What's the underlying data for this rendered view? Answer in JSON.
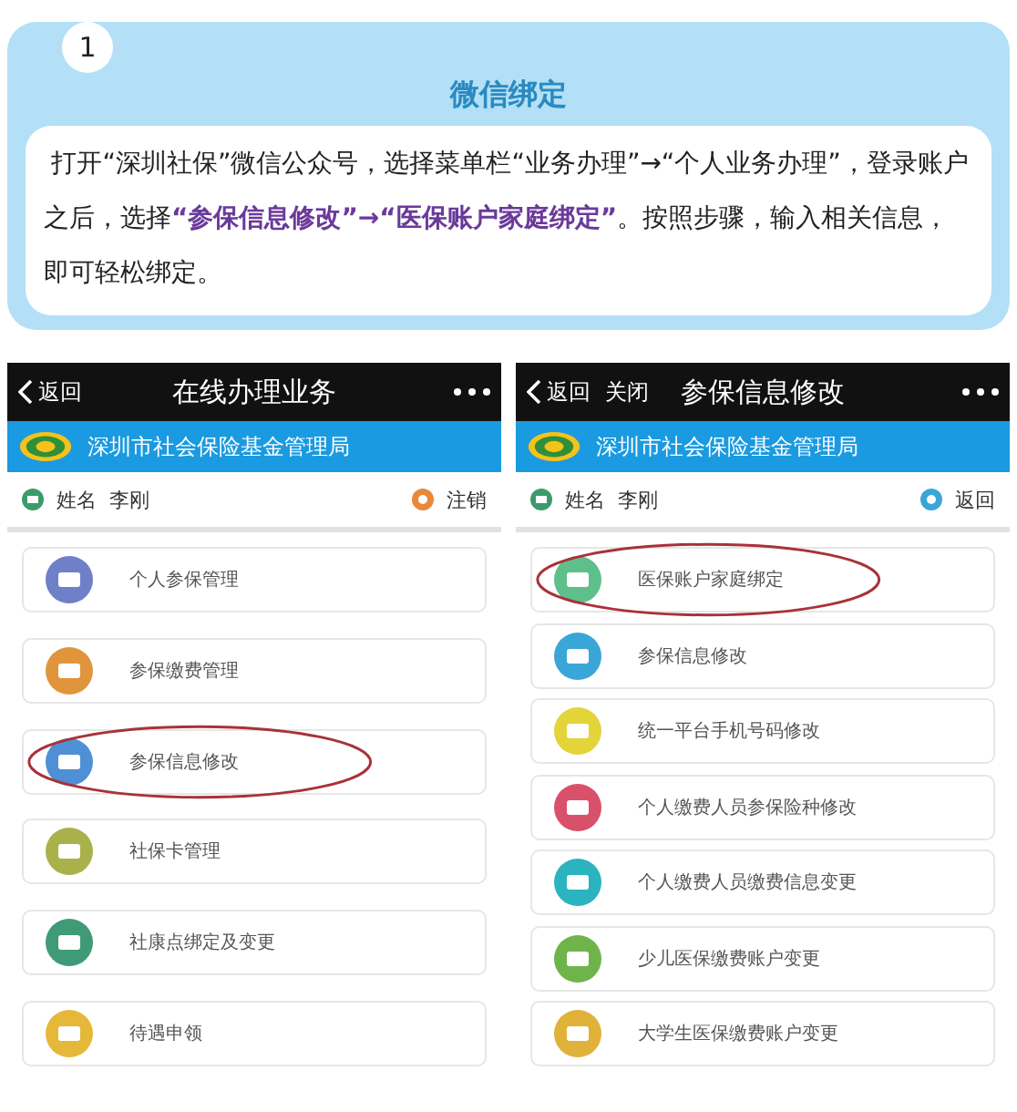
{
  "step_card": {
    "step": "1",
    "title": "微信绑定",
    "paragraph": "打开“深圳社保”微信公众号，选择菜单栏“业务办理”→“个人业务办理”，登录账户之后，选择**“参保信息修改”→“医保账户家庭绑定”**。按照步骤，输入相关信息，即可轻松绑定。"
  },
  "phones": [
    {
      "back": "返回",
      "title": "在线办理业务",
      "org": "深圳市社会保险基金管理局",
      "name_label": "姓名",
      "name": "李刚",
      "action": "注销",
      "action_icon": {
        "color": "#e8893a"
      },
      "items": [
        {
          "label": "个人参保管理",
          "color": "#6f7fc8",
          "circled": false
        },
        {
          "label": "参保缴费管理",
          "color": "#e0953c",
          "circled": false
        },
        {
          "label": "参保信息修改",
          "color": "#4f8fd6",
          "circled": true
        },
        {
          "label": "社保卡管理",
          "color": "#a9b24a",
          "circled": false
        },
        {
          "label": "社康点绑定及变更",
          "color": "#3f9a78",
          "circled": false
        },
        {
          "label": "待遇申领",
          "color": "#e5b83a",
          "circled": false
        }
      ]
    },
    {
      "back": "返回",
      "close": "关闭",
      "title": "参保信息修改",
      "org": "深圳市社会保险基金管理局",
      "name_label": "姓名",
      "name": "李刚",
      "action": "返回",
      "action_icon": {
        "color": "#3aa6d8"
      },
      "items": [
        {
          "label": "医保账户家庭绑定",
          "color": "#5fbf8a",
          "circled": true
        },
        {
          "label": "参保信息修改",
          "color": "#3aa6d8",
          "circled": false
        },
        {
          "label": "统一平台手机号码修改",
          "color": "#e3d43a",
          "circled": false
        },
        {
          "label": "个人缴费人员参保险种修改",
          "color": "#d9506a",
          "circled": false
        },
        {
          "label": "个人缴费人员缴费信息变更",
          "color": "#2bb3c0",
          "circled": false
        },
        {
          "label": "少儿医保缴费账户变更",
          "color": "#6fb44a",
          "circled": false
        },
        {
          "label": "大学生医保缴费账户变更",
          "color": "#e0b23a",
          "circled": false
        }
      ]
    }
  ]
}
